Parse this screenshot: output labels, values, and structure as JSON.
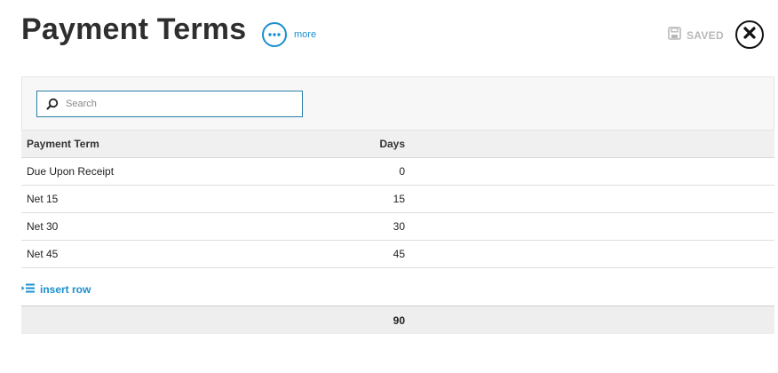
{
  "header": {
    "title": "Payment Terms",
    "more_label": "more",
    "saved_label": "SAVED"
  },
  "search": {
    "placeholder": "Search",
    "value": ""
  },
  "table": {
    "columns": [
      "Payment Term",
      "Days"
    ],
    "rows": [
      {
        "term": "Due Upon Receipt",
        "days": "0"
      },
      {
        "term": "Net 15",
        "days": "15"
      },
      {
        "term": "Net 30",
        "days": "30"
      },
      {
        "term": "Net 45",
        "days": "45"
      }
    ],
    "total_days": "90"
  },
  "actions": {
    "insert_row_label": "insert row"
  },
  "colors": {
    "accent": "#1a8fd0",
    "saved_gray": "#b8b8b8"
  },
  "icons": {
    "more": "more-dots-icon",
    "saved": "save-disk-icon",
    "close": "close-x-icon",
    "search": "search-icon",
    "insert": "insert-row-icon"
  }
}
